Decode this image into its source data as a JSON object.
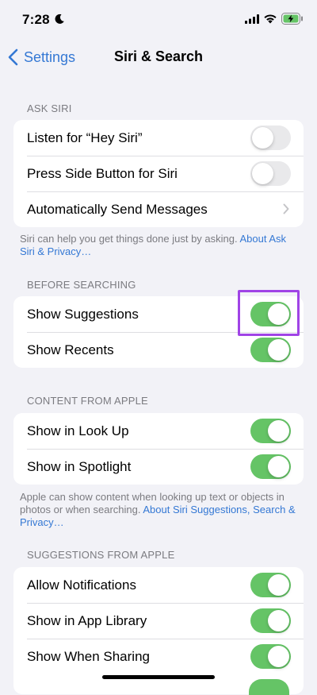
{
  "status_bar": {
    "time": "7:28",
    "icons": [
      "moon-icon",
      "cellular-signal-icon",
      "wifi-icon",
      "battery-charging-icon"
    ]
  },
  "nav": {
    "back_label": "Settings",
    "title": "Siri & Search"
  },
  "colors": {
    "accent": "#3478d4",
    "toggle_on": "#65c466",
    "toggle_off": "#e9e9eb",
    "highlight": "#a044e6"
  },
  "ask_siri": {
    "header": "ASK SIRI",
    "rows": [
      {
        "label": "Listen for “Hey Siri”",
        "control": "toggle",
        "on": false
      },
      {
        "label": "Press Side Button for Siri",
        "control": "toggle",
        "on": false
      },
      {
        "label": "Automatically Send Messages",
        "control": "chevron"
      }
    ],
    "footer_text": "Siri can help you get things done just by asking. ",
    "footer_link": "About Ask Siri & Privacy…"
  },
  "before_searching": {
    "header": "BEFORE SEARCHING",
    "rows": [
      {
        "label": "Show Suggestions",
        "control": "toggle",
        "on": true
      },
      {
        "label": "Show Recents",
        "control": "toggle",
        "on": true
      }
    ]
  },
  "content_from_apple": {
    "header": "CONTENT FROM APPLE",
    "rows": [
      {
        "label": "Show in Look Up",
        "control": "toggle",
        "on": true
      },
      {
        "label": "Show in Spotlight",
        "control": "toggle",
        "on": true
      }
    ],
    "footer_text": "Apple can show content when looking up text or objects in photos or when searching. ",
    "footer_link": "About Siri Suggestions, Search & Privacy…"
  },
  "suggestions_from_apple": {
    "header": "SUGGESTIONS FROM APPLE",
    "rows": [
      {
        "label": "Allow Notifications",
        "control": "toggle",
        "on": true
      },
      {
        "label": "Show in App Library",
        "control": "toggle",
        "on": true
      },
      {
        "label": "Show When Sharing",
        "control": "toggle",
        "on": true
      }
    ]
  }
}
